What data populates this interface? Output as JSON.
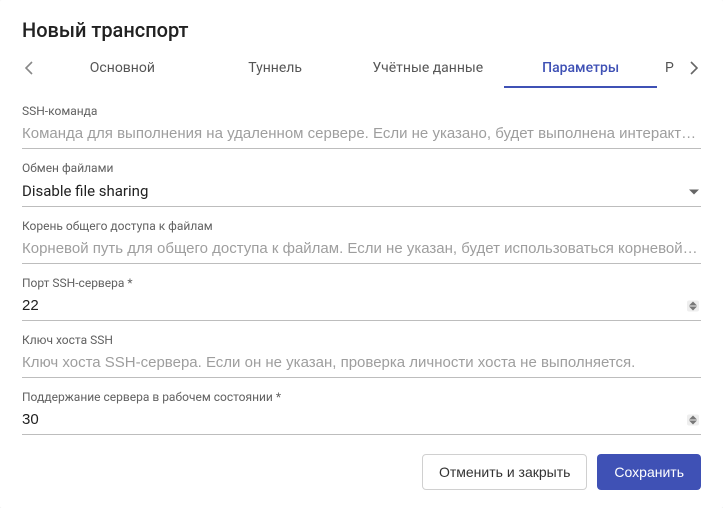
{
  "title": "Новый транспорт",
  "tabs": {
    "t0": "Основной",
    "t1": "Туннель",
    "t2": "Учётные данные",
    "t3": "Параметры",
    "t4": "Р"
  },
  "fields": {
    "ssh_command": {
      "label": "SSH-команда",
      "placeholder": "Команда для выполнения на удаленном сервере. Если не указано, будет выполнена интерактивная оболочка"
    },
    "file_sharing": {
      "label": "Обмен файлами",
      "value": "Disable file sharing"
    },
    "share_root": {
      "label": "Корень общего доступа к файлам",
      "placeholder": "Корневой путь для общего доступа к файлам. Если не указан, будет использоваться корневой каталог"
    },
    "ssh_port": {
      "label": "Порт SSH-сервера *",
      "value": "22"
    },
    "host_key": {
      "label": "Ключ хоста SSH",
      "placeholder": "Ключ хоста SSH-сервера. Если он не указан, проверка личности хоста не выполняется."
    },
    "keepalive": {
      "label": "Поддержание сервера в рабочем состоянии *",
      "value": "30"
    }
  },
  "buttons": {
    "cancel": "Отменить и закрыть",
    "save": "Сохранить"
  }
}
